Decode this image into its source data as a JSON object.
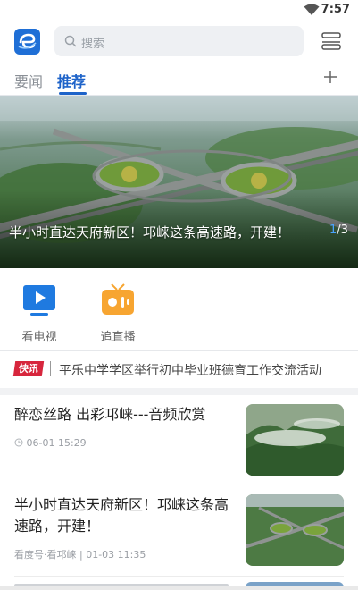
{
  "status_bar": {
    "time": "7:57"
  },
  "header": {
    "search_placeholder": "搜索"
  },
  "tabs": [
    {
      "label": "要闻",
      "active": false
    },
    {
      "label": "推荐",
      "active": true
    }
  ],
  "banner": {
    "caption": "半小时直达天府新区！邛崃这条高速路，开建！",
    "page_current": "1",
    "page_total": "/3"
  },
  "quick_links": [
    {
      "label": "看电视",
      "icon": "tv-icon"
    },
    {
      "label": "追直播",
      "icon": "live-radio-icon"
    }
  ],
  "flash": {
    "badge": "快讯",
    "text": "平乐中学学区举行初中毕业班德育工作交流活动"
  },
  "news": [
    {
      "title": "醉恋丝路 出彩邛崃---音频欣赏",
      "meta": "06-01 15:29",
      "thumb": "misty-mountain-photo"
    },
    {
      "title": "半小时直达天府新区！邛崃这条高速路，开建！",
      "meta": "看度号·看邛崃 | 01-03 11:35",
      "thumb": "highway-interchange-photo"
    }
  ],
  "colors": {
    "accent": "#1e63c9",
    "flash_badge": "#d7263d",
    "live_orange": "#f7a531"
  }
}
